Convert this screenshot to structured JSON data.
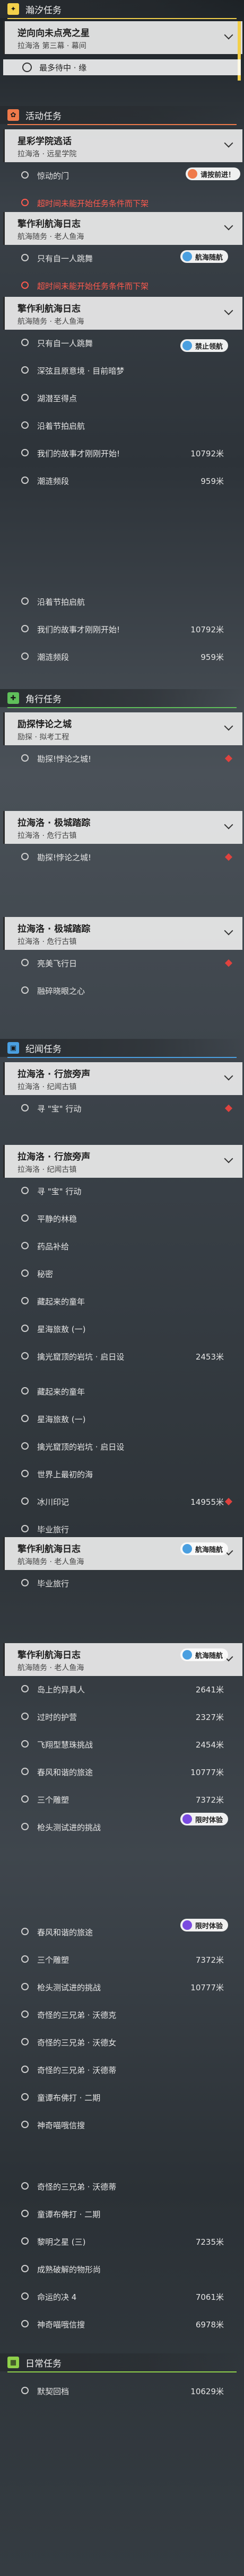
{
  "sections": {
    "world": "瀚汐任务",
    "event": "活动任务",
    "trial": "角行任务",
    "record": "纪闻任务",
    "daily": "日常任务"
  },
  "badges": {
    "reward": "请按前进！",
    "voyage": "航海随航",
    "stardrive": "禁止领航",
    "xp": "限时体验"
  },
  "world_quest": {
    "title": "逆向向未点亮之星",
    "subtitle": "拉海洛 第三幕 · 幕间",
    "step": "最多待中 · 缘"
  },
  "event_1": {
    "title": "星彩学院逃话",
    "subtitle": "拉海洛 · 远星学院",
    "rows": [
      {
        "label": "惊动的门",
        "dist": ""
      },
      {
        "label": "超时间未能开始任务条件而下架",
        "dist": ""
      }
    ]
  },
  "event_2": {
    "title": "擎作利航海日志",
    "subtitle": "航海随务 · 老人鱼海",
    "rows": [
      {
        "label": "只有自一人跳舞",
        "dist": ""
      },
      {
        "label": "超时间未能开始任务条件而下架",
        "dist": ""
      }
    ]
  },
  "event_3": {
    "title": "擎作利航海日志",
    "subtitle": "航海随务 · 老人鱼海",
    "rows": [
      {
        "label": "只有自一人跳舞",
        "dist": ""
      },
      {
        "label": "深弦且原意境 · 目前暗梦",
        "dist": ""
      },
      {
        "label": "湖潜至得点",
        "dist": ""
      },
      {
        "label": "沿着节拍启航",
        "dist": ""
      },
      {
        "label": "我们的故事才刚刚开始!",
        "dist": "10792米"
      },
      {
        "label": "潮涟频段",
        "dist": "959米"
      }
    ]
  },
  "event_4": {
    "rows": [
      {
        "label": "沿着节拍启航",
        "dist": ""
      },
      {
        "label": "我们的故事才刚刚开始!",
        "dist": "10792米"
      },
      {
        "label": "潮涟频段",
        "dist": "959米"
      }
    ]
  },
  "trial_1": {
    "title": "励探悖论之城",
    "subtitle": "励探 · 拟考工程",
    "rows": [
      {
        "label": "勘探!悖论之城!",
        "dist": ""
      }
    ]
  },
  "trial_2": {
    "title": "拉海洛 · 极城踏踪",
    "subtitle": "拉海洛 · 危行古镇",
    "rows": [
      {
        "label": "勘探!悖论之城!",
        "dist": ""
      }
    ]
  },
  "trial_3": {
    "title": "拉海洛 · 极城踏踪",
    "subtitle": "拉海洛 · 危行古镇",
    "rows": [
      {
        "label": "亮美飞行日",
        "dist": ""
      },
      {
        "label": "融碎晓眼之心",
        "dist": ""
      }
    ]
  },
  "record_1": {
    "title": "拉海洛 · 行旅旁声",
    "subtitle": "拉海洛 · 纪闻古镇",
    "rows": [
      {
        "label": "寻 \"宝\" 行动",
        "dist": ""
      }
    ]
  },
  "record_2": {
    "title": "拉海洛 · 行旅旁声",
    "subtitle": "拉海洛 · 纪闻古镇",
    "rows": [
      {
        "label": "寻 \"宝\" 行动",
        "dist": ""
      },
      {
        "label": "平静的林稳",
        "dist": ""
      },
      {
        "label": "药品补给",
        "dist": ""
      },
      {
        "label": "秘密",
        "dist": ""
      },
      {
        "label": "藏起来的童年",
        "dist": ""
      },
      {
        "label": "星海旅敖 (一)",
        "dist": ""
      },
      {
        "label": "擒光窟顶的岩坑 · 启日设",
        "dist": "2453米"
      }
    ]
  },
  "record_3": {
    "rows": [
      {
        "label": "藏起来的童年",
        "dist": ""
      },
      {
        "label": "星海旅敖 (一)",
        "dist": ""
      },
      {
        "label": "擒光窟顶的岩坑 · 启日设",
        "dist": ""
      },
      {
        "label": "世界上最初的海",
        "dist": ""
      },
      {
        "label": "冰川印记",
        "dist": "14955米"
      },
      {
        "label": "毕业旅行",
        "dist": ""
      }
    ]
  },
  "record_4": {
    "title": "擎作利航海日志",
    "subtitle": "航海随务 · 老人鱼海",
    "rows": [
      {
        "label": "毕业旅行",
        "dist": ""
      }
    ]
  },
  "record_5": {
    "title": "擎作利航海日志",
    "subtitle": "航海随务 · 老人鱼海",
    "rows": [
      {
        "label": "岛上的异具人",
        "dist": "2641米"
      },
      {
        "label": "过时的护营",
        "dist": "2327米"
      },
      {
        "label": "飞翔型慧珠挑战",
        "dist": "2454米"
      },
      {
        "label": "春风和谐的旅途",
        "dist": "10777米"
      },
      {
        "label": "三个雕塑",
        "dist": "7372米"
      },
      {
        "label": "枪头测试进的挑战",
        "dist": ""
      }
    ]
  },
  "record_6": {
    "rows": [
      {
        "label": "春风和谐的旅途",
        "dist": ""
      },
      {
        "label": "三个雕塑",
        "dist": "7372米"
      },
      {
        "label": "枪头测试进的挑战",
        "dist": "10777米"
      },
      {
        "label": "奇怪的三兄弟 · 沃德克",
        "dist": ""
      },
      {
        "label": "奇怪的三兄弟 · 沃德女",
        "dist": ""
      },
      {
        "label": "奇怪的三兄弟 · 沃德蒂",
        "dist": ""
      },
      {
        "label": "童谭布佛打 · 二期",
        "dist": ""
      },
      {
        "label": "神奇喵哦信搜",
        "dist": ""
      }
    ]
  },
  "record_7": {
    "rows": [
      {
        "label": "奇怪的三兄弟 · 沃德蒂",
        "dist": ""
      },
      {
        "label": "童谭布佛打 · 二期",
        "dist": ""
      },
      {
        "label": "黎明之星 (三)",
        "dist": "7235米"
      },
      {
        "label": "成熟破解的物形尚",
        "dist": ""
      },
      {
        "label": "命运的决 4",
        "dist": "7061米"
      },
      {
        "label": "神奇喵哦信搜",
        "dist": "6978米"
      }
    ]
  },
  "daily_1": {
    "rows": [
      {
        "label": "默契回档",
        "dist": "10629米"
      }
    ]
  },
  "colors": {
    "world": "#f3d04a",
    "event": "#ef7a4a",
    "trial": "#5fbf5a",
    "record": "#4a9fe0",
    "daily": "#8fd04a",
    "purple": "#7a4ae0",
    "green": "#3fc27a"
  }
}
